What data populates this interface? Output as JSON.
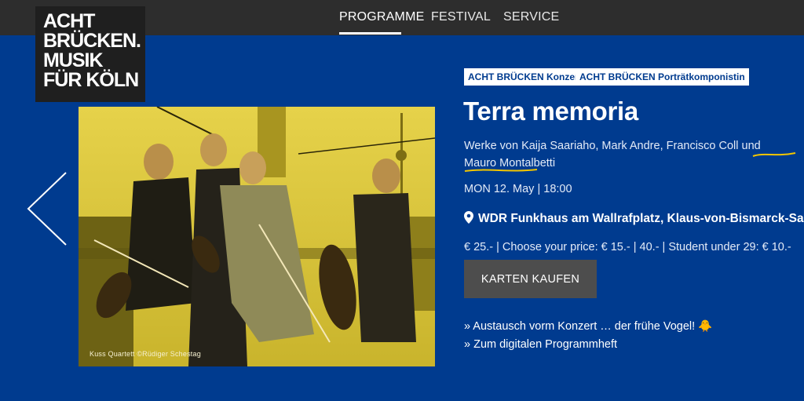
{
  "header": {
    "nav": [
      {
        "label": "PROGRAMME",
        "active": true
      },
      {
        "label": "FESTIVAL",
        "active": false
      },
      {
        "label": "SERVICE",
        "active": false
      }
    ]
  },
  "logo": {
    "lines": [
      "ACHT",
      "BRÜCKEN.",
      "MUSIK",
      "FÜR KÖLN"
    ]
  },
  "event": {
    "tags": [
      "ACHT BRÜCKEN Konzert",
      "ACHT BRÜCKEN Porträtkomponistin"
    ],
    "title": "Terra memoria",
    "works": "Werke von Kaija Saariaho, Mark Andre, Francisco Coll und Mauro Montalbetti",
    "date": "MON 12. May | 18:00",
    "venue": "WDR Funkhaus am Wallrafplatz, Klaus-von-Bismarck-Saal",
    "prices": "€ 25.- | Choose your price: € 15.- | 40.- | Student under 29: € 10.-",
    "buy_label": "KARTEN KAUFEN",
    "links": [
      "» Austausch vorm Konzert … der frühe Vogel! 🐥",
      "» Zum digitalen Programmheft"
    ]
  },
  "photo": {
    "caption": "Kuss Quartett ©Rüdiger Schestag"
  },
  "colors": {
    "background": "#003b8f",
    "topbar": "#2d2d2d",
    "tag_text": "#003b8f",
    "button": "#4d4d4d",
    "photo_tint": "#d9c534",
    "squiggle": "#f2c500"
  },
  "icons": {
    "slider_prev": "chevron-left-icon",
    "venue": "map-pin-icon"
  }
}
